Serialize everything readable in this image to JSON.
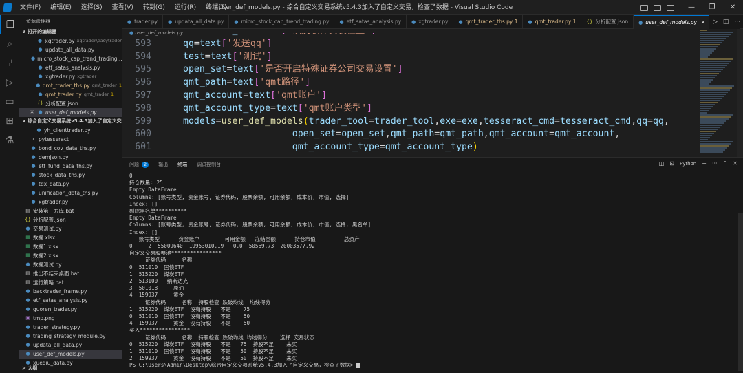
{
  "titlebar": {
    "menu": [
      "文件(F)",
      "编辑(E)",
      "选择(S)",
      "查看(V)",
      "转到(G)",
      "运行(R)",
      "终端(T)",
      "..."
    ],
    "title": "user_def_models.py - 综合自定义交易系统v5.4.3加入了自定义交易，检查了数据 - Visual Studio Code",
    "controls": [
      "—",
      "❐",
      "✕"
    ]
  },
  "sidebar": {
    "header": "资源管理器",
    "open_editors_label": "打开的编辑器",
    "open_editors": [
      {
        "close": "",
        "icon": "py",
        "name": "xqtrader.py",
        "desc": "xqtrader\\easytrader",
        "badge": ""
      },
      {
        "close": "",
        "icon": "py",
        "name": "updata_all_data.py",
        "desc": "",
        "badge": ""
      },
      {
        "close": "",
        "icon": "py",
        "name": "micro_stock_cap_trend_trading...",
        "desc": "",
        "badge": ""
      },
      {
        "close": "",
        "icon": "py",
        "name": "etf_satas_analysis.py",
        "desc": "",
        "badge": ""
      },
      {
        "close": "",
        "icon": "py",
        "name": "xgtrader.py",
        "desc": "xgtrader",
        "badge": ""
      },
      {
        "close": "",
        "icon": "py",
        "name": "qmt_trader_ths.py",
        "desc": "qmt_trader",
        "badge": "1"
      },
      {
        "close": "",
        "icon": "py",
        "name": "qmt_trader.py",
        "desc": "qmt_trader",
        "badge": "1"
      },
      {
        "close": "",
        "icon": "{}",
        "name": "分析配置.json",
        "desc": "",
        "badge": ""
      },
      {
        "close": "✕",
        "icon": "py",
        "name": "user_def_models.py",
        "desc": "",
        "badge": ""
      }
    ],
    "project_label": "综合自定义交易系统v5.4.3加入了自定义交易...",
    "files": [
      {
        "icon": "py",
        "name": "yh_clienttrader.py",
        "indent": 2
      },
      {
        "icon": ">",
        "name": "pytesseract",
        "indent": 1
      },
      {
        "icon": "py",
        "name": "bond_cov_data_ths.py",
        "indent": 1
      },
      {
        "icon": "py",
        "name": "demjson.py",
        "indent": 1
      },
      {
        "icon": "py",
        "name": "etf_fund_data_ths.py",
        "indent": 1
      },
      {
        "icon": "py",
        "name": "stock_data_ths.py",
        "indent": 1
      },
      {
        "icon": "py",
        "name": "tdx_data.py",
        "indent": 1
      },
      {
        "icon": "py",
        "name": "unification_data_ths.py",
        "indent": 1
      },
      {
        "icon": "py",
        "name": "xgtrader.py",
        "indent": 1
      },
      {
        "icon": "bat",
        "name": "安装第三方库.bat",
        "indent": 0
      },
      {
        "icon": "{}",
        "name": "分析配置.json",
        "indent": 0
      },
      {
        "icon": "py",
        "name": "交易测试.py",
        "indent": 0
      },
      {
        "icon": "xlsx",
        "name": "数据.xlsx",
        "indent": 0
      },
      {
        "icon": "xlsx",
        "name": "数据1.xlsx",
        "indent": 0
      },
      {
        "icon": "xlsx",
        "name": "数据2.xlsx",
        "indent": 0
      },
      {
        "icon": "py",
        "name": "数据测试.py",
        "indent": 0
      },
      {
        "icon": "bat",
        "name": "推出不结束桌面.bat",
        "indent": 0
      },
      {
        "icon": "bat",
        "name": "运行策略.bat",
        "indent": 0
      },
      {
        "icon": "py",
        "name": "backtrader_frame.py",
        "indent": 0
      },
      {
        "icon": "py",
        "name": "etf_satas_analysis.py",
        "indent": 0
      },
      {
        "icon": "py",
        "name": "guoren_trader.py",
        "indent": 0
      },
      {
        "icon": "png",
        "name": "tmp.png",
        "indent": 0
      },
      {
        "icon": "py",
        "name": "trader_strategy.py",
        "indent": 0
      },
      {
        "icon": "py",
        "name": "trading_strategy_module.py",
        "indent": 0
      },
      {
        "icon": "py",
        "name": "updata_all_data.py",
        "indent": 0
      },
      {
        "icon": "py",
        "name": "user_def_models.py",
        "indent": 0,
        "selected": true
      },
      {
        "icon": "py",
        "name": "xueqiu_data.py",
        "indent": 0
      }
    ],
    "outline_label": "大纲"
  },
  "tabs": [
    {
      "name": "trader.py",
      "modified": false,
      "active": false
    },
    {
      "name": "updata_all_data.py",
      "modified": false,
      "active": false
    },
    {
      "name": "micro_stock_cap_trend_trading.py",
      "modified": false,
      "active": false
    },
    {
      "name": "etf_satas_analysis.py",
      "modified": false,
      "active": false
    },
    {
      "name": "xgtrader.py",
      "modified": false,
      "active": false
    },
    {
      "name": "qmt_trader_ths.py 1",
      "modified": true,
      "active": false
    },
    {
      "name": "qmt_trader.py 1",
      "modified": true,
      "active": false
    },
    {
      "name": "分析配置.json",
      "modified": false,
      "active": false,
      "json": true
    },
    {
      "name": "user_def_models.py",
      "modified": false,
      "active": true
    }
  ],
  "breadcrumb": "user_def_models.py",
  "code": {
    "lines": [
      {
        "n": "592",
        "text": "tesseract_cmd=text['识别软件安装位置']"
      },
      {
        "n": "593",
        "text": "qq=text['发送qq']"
      },
      {
        "n": "594",
        "text": "test=text['测试']"
      },
      {
        "n": "595",
        "text": "open_set=text['是否开启特殊证券公司交易设置']"
      },
      {
        "n": "596",
        "text": "qmt_path=text['qmt路径']"
      },
      {
        "n": "597",
        "text": "qmt_account=text['qmt账户']"
      },
      {
        "n": "598",
        "text": "qmt_account_type=text['qmt账户类型']"
      },
      {
        "n": "599",
        "text": "models=user_def_models(trader_tool=trader_tool,exe=exe,tesseract_cmd=tesseract_cmd,qq=qq,"
      },
      {
        "n": "600",
        "text": "                    open_set=open_set,qmt_path=qmt_path,qmt_account=qmt_account,"
      },
      {
        "n": "601",
        "text": "                    qmt_account_type=qmt_account_type)"
      }
    ]
  },
  "panel": {
    "tabs": [
      {
        "label": "问题",
        "count": "2"
      },
      {
        "label": "输出",
        "count": ""
      },
      {
        "label": "终端",
        "count": "",
        "active": true
      },
      {
        "label": "调试控制台",
        "count": ""
      }
    ],
    "shell": "Python",
    "terminal_lines": [
      "0",
      "持仓数量: 25",
      "Empty DataFrame",
      "Columns: [账号类型, 资金账号, 证券代码, 股票余额, 可用余额, 成本价, 市值, 选择]",
      "Index: []",
      "剔除黑名单**********",
      "Empty DataFrame",
      "Columns: [账号类型, 资金账号, 证券代码, 股票余额, 可用余额, 成本价, 市值, 选择, 黑名单]",
      "Index: []",
      "   账号类型      资金账户        可用金额   冻结金额      持仓市值         总资产",
      "0     2  55009640  19953010.19   0.0  50569.73  20003577.92",
      "自定义交易股票池****************",
      "     证券代码     名称",
      "0  511010  国债ETF",
      "1  515220  煤炭ETF",
      "2  513100   纳斯达克",
      "3  501018     原油",
      "4  159937     黄金",
      "     证券代码     名称  持股检查 跌破均线  均线得分",
      "1  515220  煤炭ETF  没有持股   不是    75",
      "0  511010  国债ETF  没有持股   不是    50",
      "4  159937     黄金  没有持股   不是    50",
      "买入****************",
      "     证券代码     名称  持股检查 跌破均线 均线得分    选择 交易状态",
      "0  515220  煤炭ETF  没有持股   不是   75  持股不足    未买",
      "1  511010  国债ETF  没有持股   不是   50  持股不足    未买",
      "2  159937     黄金  没有持股   不是   50  持股不足    未买",
      "PS C:\\Users\\Admin\\Desktop\\综合自定义交易系统v5.4.3加入了自定义交易，检查了数据> "
    ]
  }
}
